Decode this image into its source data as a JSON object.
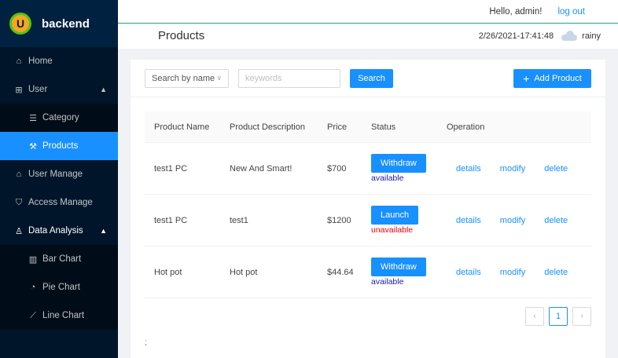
{
  "app": {
    "logo_letter": "U",
    "title": "backend"
  },
  "sidebar": {
    "items": [
      {
        "label": "Home",
        "icon": "home-icon"
      },
      {
        "label": "User",
        "icon": "appstore-icon",
        "expanded": true
      },
      {
        "label": "Category",
        "icon": "list-icon"
      },
      {
        "label": "Products",
        "icon": "tool-icon",
        "active": true
      },
      {
        "label": "User Manage",
        "icon": "home-icon"
      },
      {
        "label": "Access Manage",
        "icon": "safety-icon"
      },
      {
        "label": "Data Analysis",
        "icon": "user-icon",
        "expanded": true
      },
      {
        "label": "Bar Chart",
        "icon": "bar-chart-icon"
      },
      {
        "label": "Pie Chart",
        "icon": "pie-chart-icon"
      },
      {
        "label": "Line Chart",
        "icon": "line-chart-icon"
      }
    ]
  },
  "header": {
    "greeting": "Hello, admin!",
    "logout": "log out",
    "page_title": "Products",
    "datetime": "2/26/2021-17:41:48",
    "weather": "rainy"
  },
  "toolbar": {
    "select_value": "Search by name",
    "search_placeholder": "keywords",
    "search_label": "Search",
    "add_label": "Add Product"
  },
  "table": {
    "columns": [
      "Product Name",
      "Product Description",
      "Price",
      "Status",
      "Operation"
    ],
    "rows": [
      {
        "name": "test1 PC",
        "desc": "New And Smart!",
        "price": "$700",
        "action": "Withdraw",
        "status": "available",
        "ops": [
          "details",
          "modify",
          "delete"
        ]
      },
      {
        "name": "test1 PC",
        "desc": "test1",
        "price": "$1200",
        "action": "Launch",
        "status": "unavailable",
        "ops": [
          "details",
          "modify",
          "delete"
        ]
      },
      {
        "name": "Hot pot",
        "desc": "Hot pot",
        "price": "$44.64",
        "action": "Withdraw",
        "status": "available",
        "ops": [
          "details",
          "modify",
          "delete"
        ]
      }
    ]
  },
  "pagination": {
    "prev": "‹",
    "current": "1",
    "next": "›"
  },
  "footer_mark": ";",
  "colors": {
    "accent": "#1890ff",
    "sidebar_bg": "#001529",
    "available": "#1a1aa6",
    "unavailable": "#e8000b"
  }
}
